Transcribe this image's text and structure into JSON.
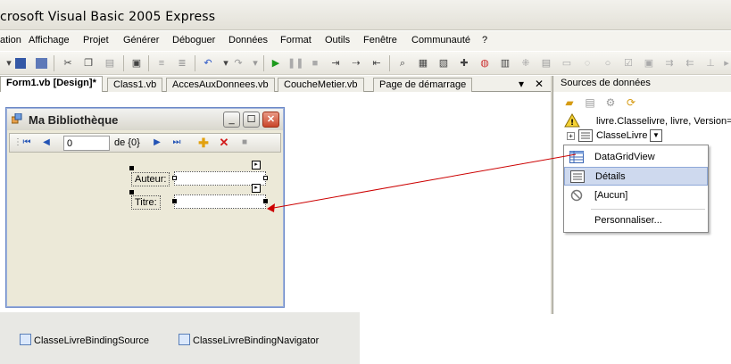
{
  "window": {
    "title": "crosoft Visual Basic 2005 Express"
  },
  "menu": [
    "ation",
    "Affichage",
    "Projet",
    "Générer",
    "Déboguer",
    "Données",
    "Format",
    "Outils",
    "Fenêtre",
    "Communauté",
    "?"
  ],
  "tabs": [
    {
      "label": "Form1.vb [Design]*",
      "active": true
    },
    {
      "label": "Class1.vb",
      "active": false
    },
    {
      "label": "AccesAuxDonnees.vb",
      "active": false
    },
    {
      "label": "CoucheMetier.vb",
      "active": false
    },
    {
      "label": "Page de démarrage",
      "active": false
    }
  ],
  "tab_controls": {
    "dropdown": "▾",
    "close": "✕"
  },
  "form": {
    "title": "Ma Bibliothèque",
    "navigator": {
      "position": "0",
      "count_text": "de {0}"
    },
    "author_label": "Auteur:",
    "title_label": "Titre:"
  },
  "tray": {
    "items": [
      "ClasseLivreBindingSource",
      "ClasseLivreBindingNavigator"
    ]
  },
  "data_sources": {
    "panel_title": "Sources de données",
    "tree": {
      "root": "livre.Classelivre, livre, Version=",
      "child": "ClasseLivre"
    },
    "menu_items": [
      {
        "label": "DataGridView",
        "icon": "datagridview-icon",
        "selected": false
      },
      {
        "label": "Détails",
        "icon": "details-icon",
        "selected": true
      },
      {
        "label": "[Aucun]",
        "icon": "none-icon",
        "selected": false
      },
      {
        "label": "Personnaliser...",
        "icon": "",
        "selected": false
      }
    ]
  },
  "colors": {
    "arrow": "#cc0000",
    "selection": "#ced9ee",
    "form_border": "#6b88c7"
  }
}
